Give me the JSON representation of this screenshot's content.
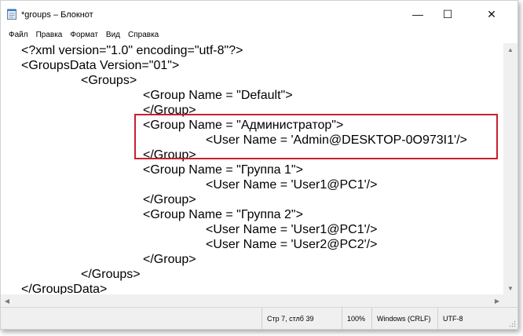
{
  "window": {
    "title": "*groups – Блокнот",
    "controls": {
      "minimize": "—",
      "maximize": "☐",
      "close": "✕"
    }
  },
  "menu": {
    "items": [
      "Файл",
      "Правка",
      "Формат",
      "Вид",
      "Справка"
    ]
  },
  "editor": {
    "lines": [
      "<?xml version=\"1.0\" encoding=\"utf-8\"?>",
      "<GroupsData Version=\"01\">",
      "\t<Groups>",
      "\t\t<Group Name = \"Default\">",
      "\t\t</Group>",
      "\t\t<Group Name = \"Администратор\">",
      "\t\t\t<User Name = 'Admin@DESKTOP-0O973I1'/>",
      "\t\t</Group>",
      "\t\t<Group Name = \"Группа 1\">",
      "\t\t\t<User Name = 'User1@PC1'/>",
      "\t\t</Group>",
      "\t\t<Group Name = \"Группа 2\">",
      "\t\t\t<User Name = 'User1@PC1'/>",
      "\t\t\t<User Name = 'User2@PC2'/>",
      "\t\t</Group>",
      "\t</Groups>",
      "</GroupsData>"
    ],
    "highlight_color": "#c8202e"
  },
  "status": {
    "position": "Стр 7, стлб 39",
    "zoom": "100%",
    "line_ending": "Windows (CRLF)",
    "encoding": "UTF-8"
  },
  "scroll": {
    "up": "▲",
    "down": "▼",
    "left": "◀",
    "right": "▶"
  }
}
